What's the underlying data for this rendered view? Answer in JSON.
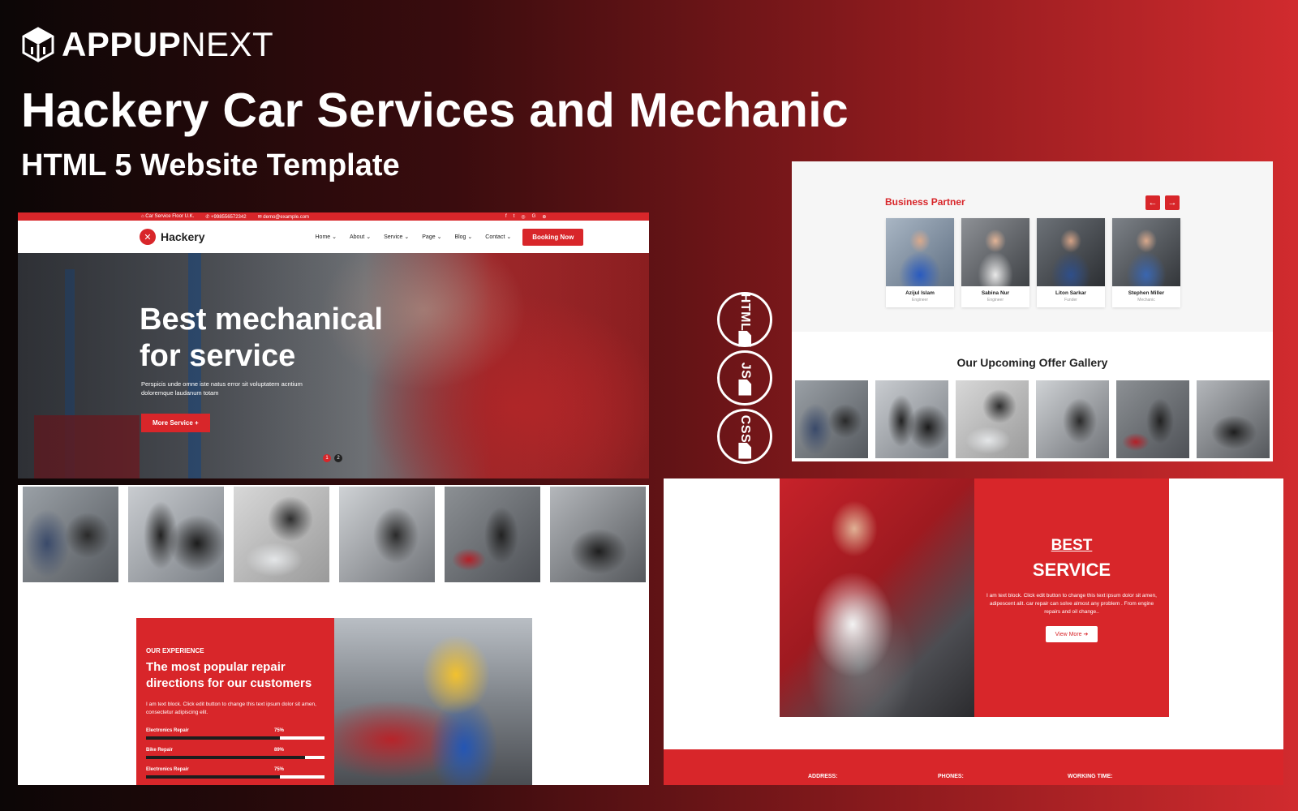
{
  "brand": {
    "name_bold": "APPUP",
    "name_light": "NEXT"
  },
  "title": "Hackery Car Services and Mechanic",
  "subtitle": "HTML 5 Website Template",
  "hero": {
    "topbar": {
      "address": "Car Service Floor U.K.",
      "phone": "+998556572342",
      "email": "demo@example.com"
    },
    "logo_text": "Hackery",
    "nav": [
      "Home",
      "About",
      "Service",
      "Page",
      "Blog",
      "Contact"
    ],
    "booking_label": "Booking Now",
    "heading_line1": "Best mechanical",
    "heading_line2": "for service",
    "description": "Perspicis unde omne iste natus error sit voluptatem acntium doloremque laudanum totam",
    "cta_label": "More Service +",
    "slides": [
      "1",
      "2"
    ]
  },
  "experience": {
    "kicker": "OUR EXPERIENCE",
    "title": "The most popular repair directions for our customers",
    "description": "I am text block. Click edit button to change this text ipsum dolor sit amen, consectetur adipiscing elit.",
    "skills": [
      {
        "label": "Electronics Repair",
        "percent": "75%",
        "value": 75
      },
      {
        "label": "Bike Repair",
        "percent": "89%",
        "value": 89
      },
      {
        "label": "Electronics Repair",
        "percent": "75%",
        "value": 75
      }
    ]
  },
  "tech_badges": [
    "HTML",
    "JS",
    "CSS"
  ],
  "business": {
    "title": "Business Partner",
    "prev_icon": "arrow-left-icon",
    "next_icon": "arrow-right-icon",
    "members": [
      {
        "name": "Azijul Islam",
        "role": "Engineer"
      },
      {
        "name": "Sabina Nur",
        "role": "Engineer"
      },
      {
        "name": "Liton Sarkar",
        "role": "Funder"
      },
      {
        "name": "Stephen Miller",
        "role": "Mechanic"
      }
    ]
  },
  "gallery_title": "Our Upcoming Offer Gallery",
  "best_service": {
    "heading1": "BEST",
    "heading2": "SERVICE",
    "description": "I am text block. Click edit button to change this text ipsum dolor sit amen, adipescent alit. car repair can solve almost any problem . From engine repairs and oil change..",
    "button_label": "View More"
  },
  "footer": {
    "address": "ADDRESS:",
    "phones": "PHONES:",
    "working": "WORKING TIME:"
  },
  "colors": {
    "accent": "#d8262a",
    "dark": "#1d1d1d"
  }
}
